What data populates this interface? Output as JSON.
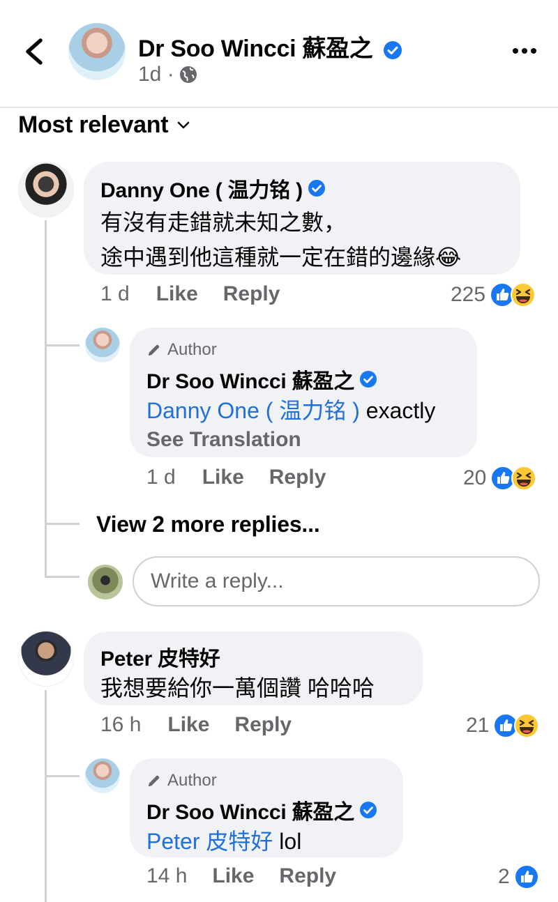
{
  "header": {
    "back_icon": "chevron-left-icon",
    "name": "Dr Soo Wincci 蘇盈之",
    "time": "1d ·",
    "privacy_icon": "globe-icon",
    "more_icon": "more-horizontal-icon"
  },
  "filter": {
    "label": "Most relevant",
    "icon": "chevron-down-icon"
  },
  "comments": [
    {
      "author": "Danny One ( 温力铭 )",
      "verified": true,
      "lines": [
        "有沒有走錯就未知之數，",
        "途中遇到他這種就一定在錯的邊緣😂"
      ],
      "time": "1 d",
      "like": "Like",
      "reply": "Reply",
      "reaction_count": "225",
      "reactions": [
        "like-reaction-icon",
        "haha-reaction-icon"
      ],
      "replies": [
        {
          "tag": "Author",
          "tag_icon": "pencil-icon",
          "author": "Dr Soo Wincci 蘇盈之",
          "verified": true,
          "mention": "Danny One ( 温力铭 )",
          "text": " exactly",
          "see_translation": "See Translation",
          "time": "1 d",
          "like": "Like",
          "reply": "Reply",
          "reaction_count": "20",
          "reactions": [
            "like-reaction-icon",
            "haha-reaction-icon"
          ]
        }
      ],
      "view_more": "View 2 more replies...",
      "reply_placeholder": "Write a reply..."
    },
    {
      "author": "Peter 皮特好",
      "verified": false,
      "lines": [
        "我想要給你一萬個讚 哈哈哈"
      ],
      "time": "16 h",
      "like": "Like",
      "reply": "Reply",
      "reaction_count": "21",
      "reactions": [
        "like-reaction-icon",
        "haha-reaction-icon"
      ],
      "replies": [
        {
          "tag": "Author",
          "tag_icon": "pencil-icon",
          "author": "Dr Soo Wincci 蘇盈之",
          "verified": true,
          "mention": "Peter 皮特好",
          "text": " lol",
          "time": "14 h",
          "like": "Like",
          "reply": "Reply",
          "reaction_count": "2",
          "reactions": [
            "like-reaction-icon"
          ]
        }
      ]
    }
  ],
  "colors": {
    "accent": "#1877f2",
    "mention": "#216fdb",
    "bubble": "#f0f2f5",
    "muted": "#65676b"
  }
}
